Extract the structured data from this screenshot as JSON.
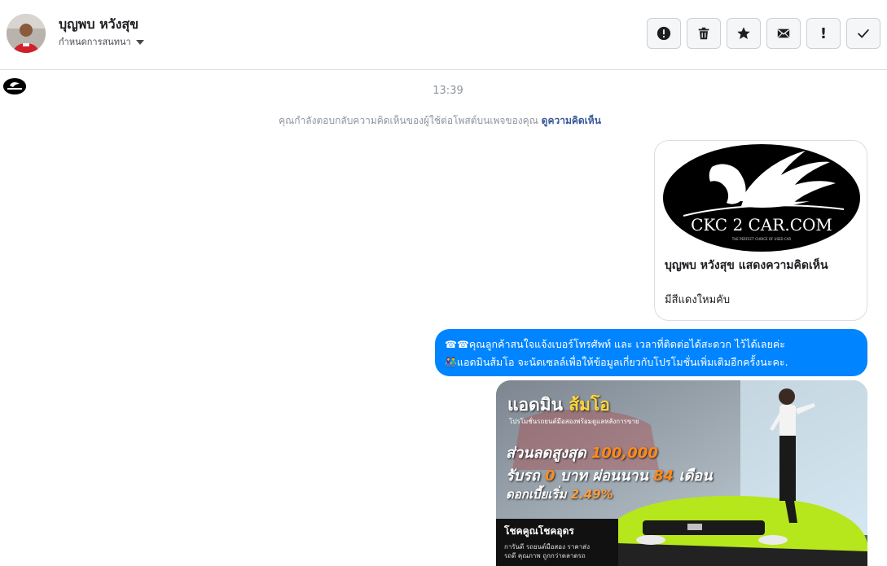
{
  "header": {
    "user_name": "บุญพบ หวังสุข",
    "assign_label": "กำหนดการสนทนา"
  },
  "toolbar": {
    "buttons": [
      {
        "name": "report-spam",
        "icon": "alert-circle-icon"
      },
      {
        "name": "delete",
        "icon": "trash-icon"
      },
      {
        "name": "star",
        "icon": "star-icon"
      },
      {
        "name": "mark-unread",
        "icon": "envelope-icon"
      },
      {
        "name": "priority",
        "icon": "exclamation-icon",
        "glyph": "!"
      },
      {
        "name": "mark-done",
        "icon": "check-icon"
      }
    ]
  },
  "thread": {
    "timestamp": "13:39",
    "notice_text": "คุณกำลังตอบกลับความคิดเห็นของผู้ใช้ต่อโพสต์บนเพจของคุณ",
    "notice_link": "ดูความคิดเห็น",
    "comment_card": {
      "logo_text": "CKC 2 CAR.COM",
      "logo_tagline": "THE PERFECT CHOICE OF USED CAR",
      "title": "บุญพบ หวังสุข แสดงความคิดเห็น",
      "text": "มีสีแดงใหมคับ"
    },
    "reply_bubble": {
      "emoji_1": "☎☎",
      "line_1": "คุณลูกค้าสนใจแจ้งเบอร์โทรศัพท์ และ เวลาที่ติดต่อได้สะดวก ไว้ได้เลยค่ะ",
      "emoji_2": "👫",
      "line_2": "แอดมินส้มโอ จะนัดเซลล์เพื่อให้ข้อมูลเกี่ยวกับโปรโมชั่นเพิ่มเติมอีกครั้งนะคะ."
    },
    "promo_image": {
      "title_white": "แอดมิน",
      "title_accent": "ส้มโอ",
      "subtitle": "โปรโมชั่นรถยนต์มือสองพร้อมดูแลหลังการขาย",
      "line1_text": "ส่วนลดสูงสุด",
      "line1_num": "100,000",
      "line2_a": "รับรถ",
      "line2_num1": "0",
      "line2_b": "บาท ผ่อนนาน",
      "line2_num2": "84",
      "line2_c": "เดือน",
      "line3_text": "ดอกเบี้ยเริ่ม",
      "line3_num": "2.49%",
      "box_title": "โชคคูณโชคอุดร",
      "box_line1": "การันตี รถยนต์มือสอง ราคาส่ง",
      "box_line2": "รถดี คุณภาพ ถูกกว่าตลาดรถ"
    }
  }
}
